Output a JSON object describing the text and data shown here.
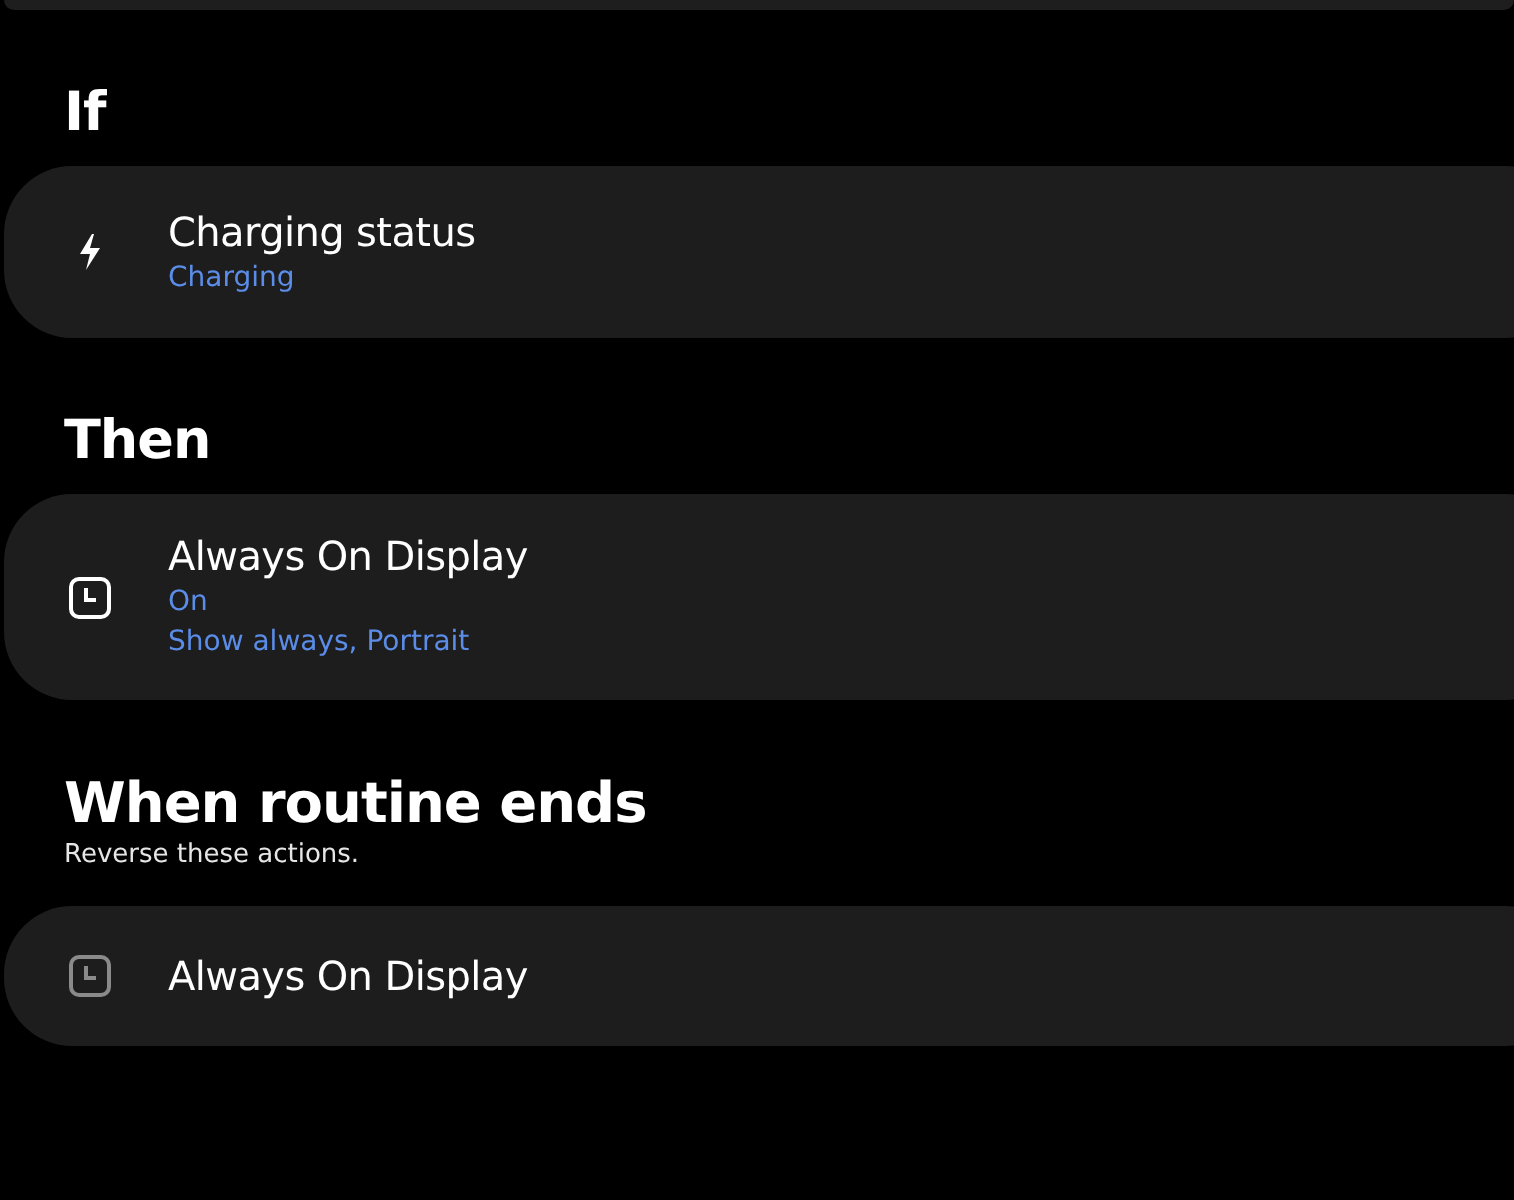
{
  "sections": [
    {
      "heading": "If",
      "cards": [
        {
          "kind": "bolt",
          "dimmed": false,
          "title": "Charging status",
          "details": [
            "Charging"
          ]
        }
      ]
    },
    {
      "heading": "Then",
      "cards": [
        {
          "kind": "clock",
          "dimmed": false,
          "title": "Always On Display",
          "details": [
            "On",
            "Show always, Portrait"
          ]
        }
      ]
    },
    {
      "heading": "When routine ends",
      "subtitle": "Reverse these actions.",
      "cards": [
        {
          "kind": "clock",
          "dimmed": true,
          "title": "Always On Display"
        }
      ]
    }
  ]
}
